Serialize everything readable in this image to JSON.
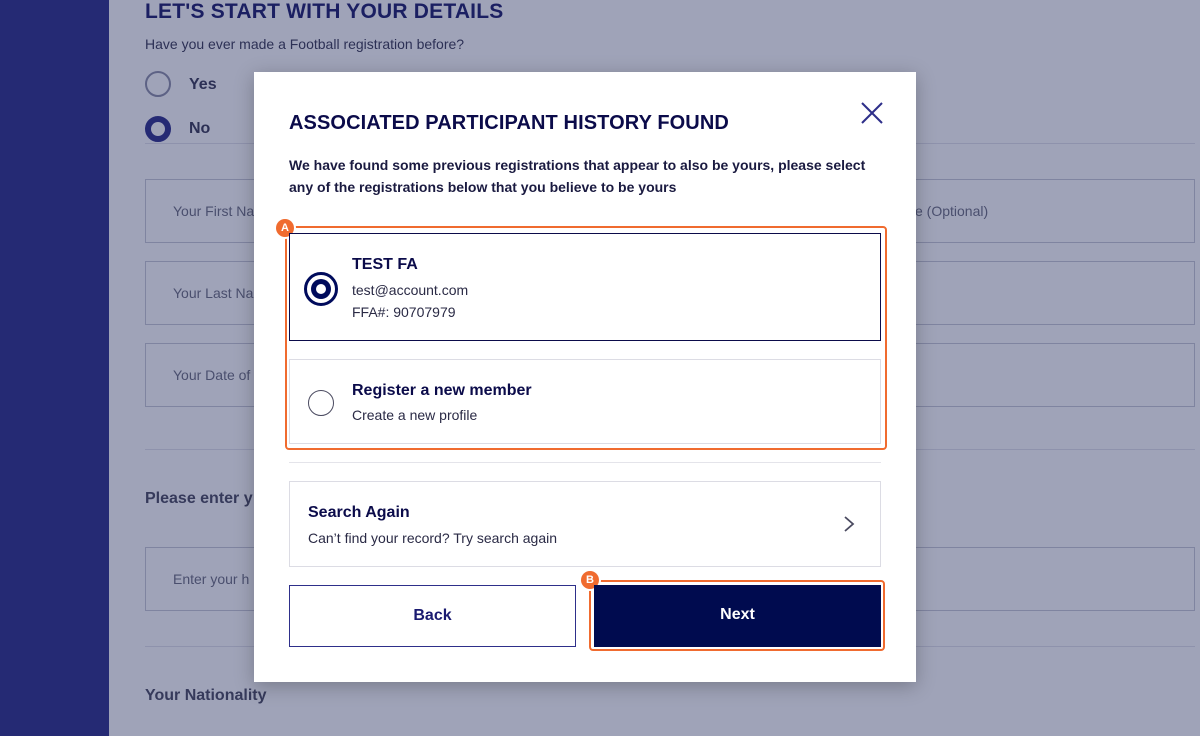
{
  "background": {
    "heading": "LET'S START WITH YOUR DETAILS",
    "question": "Have you ever made a Football registration before?",
    "radio_yes": "Yes",
    "radio_no": "No",
    "first_name_placeholder": "Your First Na",
    "middle_name_optional": "e (Optional)",
    "last_name_placeholder": "Your Last Na",
    "dob_placeholder": "Your Date of",
    "section_please_enter": "Please enter y",
    "enter_placeholder": "Enter your h",
    "section_nationality": "Your Nationality"
  },
  "modal": {
    "title": "ASSOCIATED PARTICIPANT HISTORY FOUND",
    "description": "We have found some previous registrations that appear to also be yours, please select any of the registrations below that you believe to be yours",
    "close_icon": "close-icon",
    "options": [
      {
        "title": "TEST FA",
        "email": "test@account.com",
        "ffa": "FFA#: 90707979",
        "selected": true
      },
      {
        "title": "Register a new member",
        "subtitle": "Create a new profile",
        "selected": false
      }
    ],
    "search_again": {
      "title": "Search Again",
      "subtitle": "Can’t find your record? Try search again",
      "icon": "chevron-right-icon"
    },
    "back_label": "Back",
    "next_label": "Next"
  },
  "annotations": {
    "a": "A",
    "b": "B"
  },
  "colors": {
    "navy": "#000b4f",
    "accent": "#2e2f8a",
    "annotation": "#f06b2f"
  }
}
